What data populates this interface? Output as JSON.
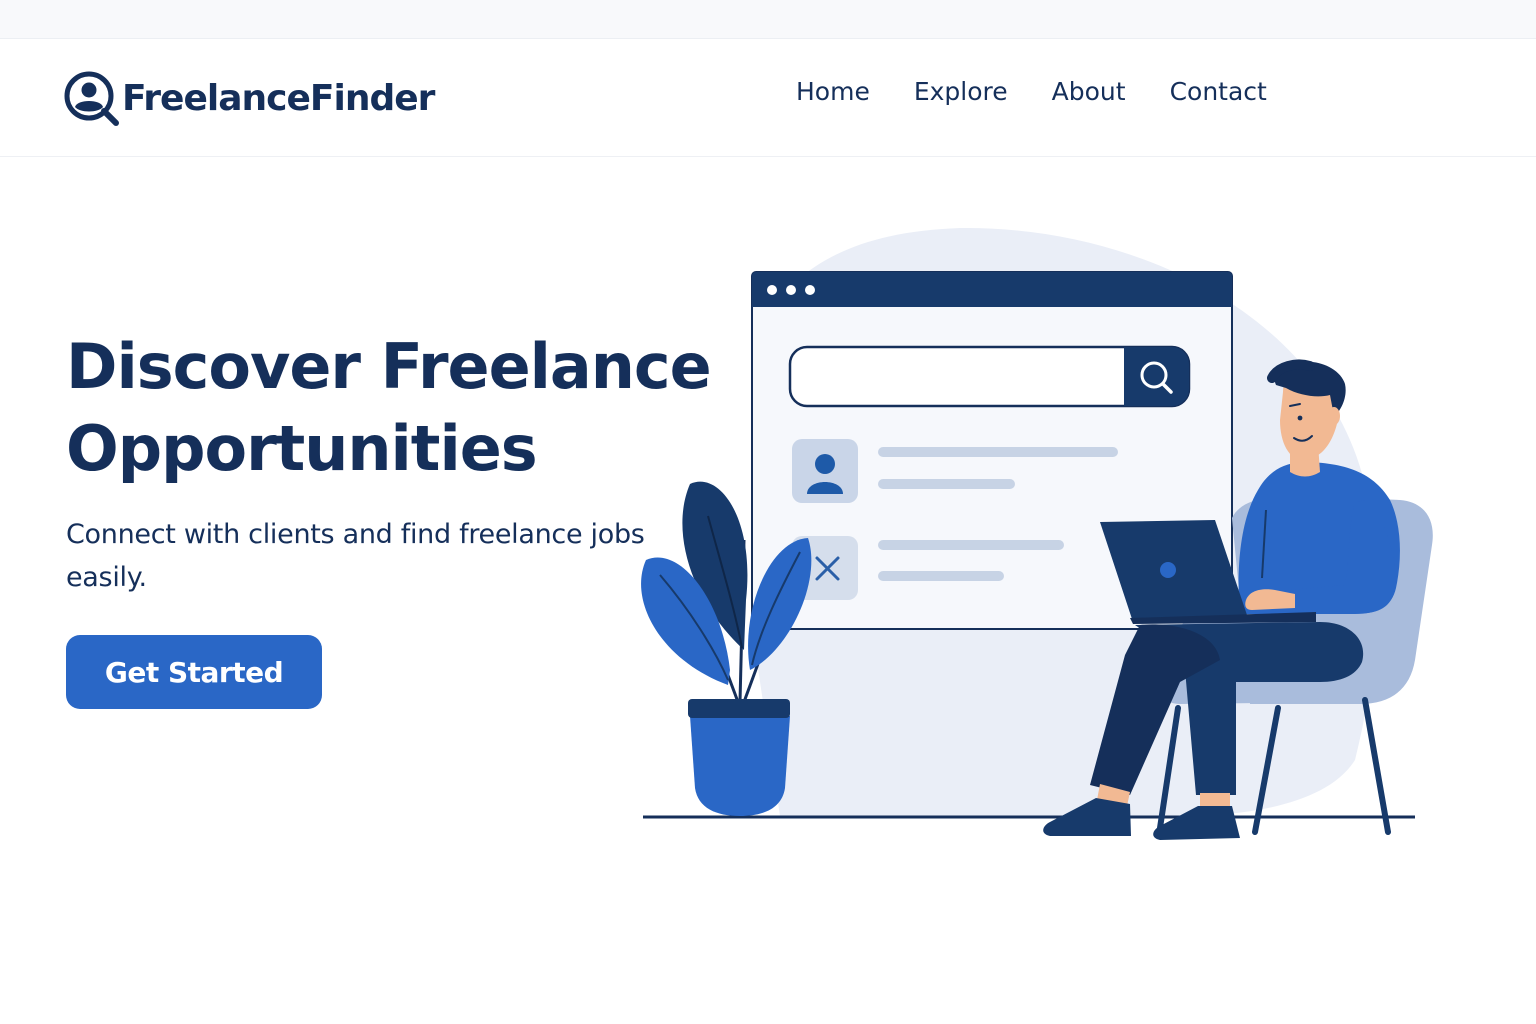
{
  "brand": {
    "name": "FreelanceFinder",
    "colors": {
      "primary": "#2a67c6",
      "navy": "#152f5a",
      "light_bg": "#eaeef7"
    }
  },
  "nav": {
    "items": [
      {
        "label": "Home"
      },
      {
        "label": "Explore"
      },
      {
        "label": "About"
      },
      {
        "label": "Contact"
      }
    ]
  },
  "hero": {
    "title_line1": "Discover Freelance",
    "title_line2": "Opportunities",
    "subtitle": "Connect with clients and find freelance jobs easily.",
    "cta_label": "Get Started"
  },
  "illustration": {
    "search_input_value": "",
    "icons": [
      "search-icon",
      "user-icon",
      "close-icon",
      "plant",
      "laptop",
      "person-sitting"
    ]
  }
}
